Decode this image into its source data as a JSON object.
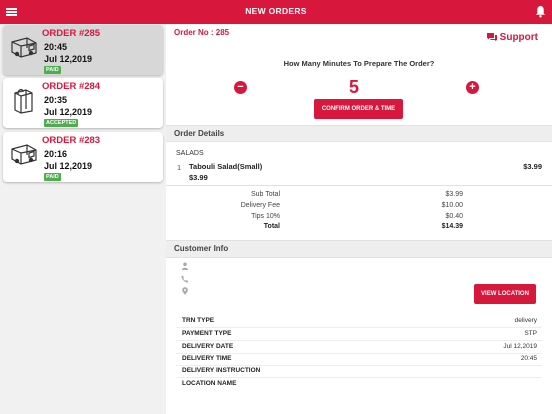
{
  "header": {
    "title": "NEW ORDERS",
    "menu_icon": "hamburger-menu-icon",
    "bell_icon": "bell-icon"
  },
  "colors": {
    "brand": "#d8173c",
    "badge_green": "#4cae4c"
  },
  "orders": [
    {
      "number": "ORDER #285",
      "time": "20:45",
      "date": "Jul 12,2019",
      "status": "PAID",
      "icon": "delivery-van-icon",
      "selected": true
    },
    {
      "number": "ORDER #284",
      "time": "20:35",
      "date": "Jul 12,2019",
      "status": "ACCEPTED",
      "icon": "shopping-bag-icon",
      "selected": false
    },
    {
      "number": "ORDER #283",
      "time": "20:16",
      "date": "Jul 12,2019",
      "status": "PAID",
      "icon": "delivery-van-icon",
      "selected": false
    }
  ],
  "detail": {
    "order_no": "Order No : 285",
    "support_label": "Support",
    "question": "How Many Minutes To Prepare The Order?",
    "minus": "−",
    "plus": "+",
    "minutes": "5",
    "confirm_label": "CONFIRM ORDER & TIME",
    "order_details_title": "Order Details",
    "category": "SALADS",
    "item": {
      "qty": "1",
      "name": "Tabouli Salad(Small)",
      "price": "$3.99",
      "unit_price": "$3.99"
    },
    "totals": [
      {
        "label": "Sub Total",
        "value": "$3.99",
        "bold": false
      },
      {
        "label": "Delivery Fee",
        "value": "$10.00",
        "bold": false
      },
      {
        "label": "Tips 10%",
        "value": "$0.40",
        "bold": false
      },
      {
        "label": "Total",
        "value": "$14.39",
        "bold": true
      }
    ],
    "customer_info_title": "Customer Info",
    "customer_icons": [
      "person-icon",
      "phone-icon",
      "location-pin-icon"
    ],
    "view_location_label": "VIEW LOCATION",
    "info_rows": [
      {
        "label": "TRN TYPE",
        "value": "delivery"
      },
      {
        "label": "PAYMENT TYPE",
        "value": "STP"
      },
      {
        "label": "DELIVERY DATE",
        "value": "Jul 12,2019"
      },
      {
        "label": "DELIVERY TIME",
        "value": "20:45"
      },
      {
        "label": "DELIVERY INSTRUCTION",
        "value": ""
      },
      {
        "label": "LOCATION NAME",
        "value": ""
      }
    ]
  }
}
